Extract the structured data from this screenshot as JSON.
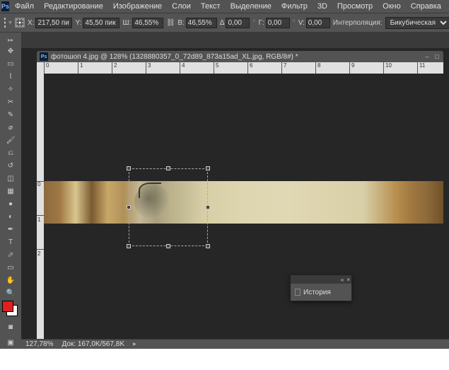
{
  "menubar": {
    "items": [
      "Файл",
      "Редактирование",
      "Изображение",
      "Слои",
      "Текст",
      "Выделение",
      "Фильтр",
      "3D",
      "Просмотр",
      "Окно",
      "Справка"
    ]
  },
  "optbar": {
    "x_label": "X:",
    "x_value": "217,50 пи",
    "y_label": "Y:",
    "y_value": "45,50 пик",
    "w_label": "Ш:",
    "w_value": "46,55%",
    "h_label": "В:",
    "h_value": "46,55%",
    "angle_label": "Δ",
    "angle_value": "0,00",
    "skew_h_label": "Г:",
    "skew_h_value": "0,00",
    "skew_v_label": "V:",
    "skew_v_value": "0,00",
    "interp_label": "Интерполяция:",
    "interp_value": "Бикубическая"
  },
  "doc": {
    "title": "фотошоп 4.jpg @ 128% (1328880357_0_72d89_873a15ad_XL.jpg, RGB/8#) *"
  },
  "ruler_h": [
    "0",
    "1",
    "2",
    "3",
    "4",
    "5",
    "6",
    "7",
    "8",
    "9",
    "10",
    "11"
  ],
  "ruler_v_zero": "0",
  "ruler_v_ticks": [
    "1",
    "2"
  ],
  "history": {
    "title": "История"
  },
  "status": {
    "zoom": "127,78%",
    "doc": "Док: 167,0K/567,8K"
  }
}
